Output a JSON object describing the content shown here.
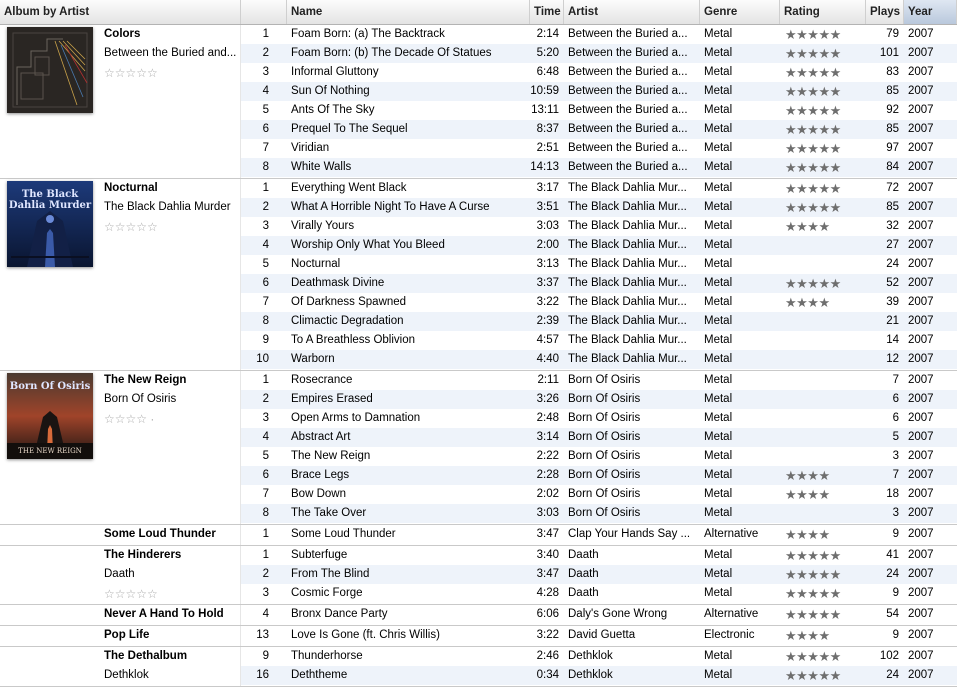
{
  "columns": {
    "album_by_artist": "Album by Artist",
    "name": "Name",
    "time": "Time",
    "artist": "Artist",
    "genre": "Genre",
    "rating": "Rating",
    "plays": "Plays",
    "year": "Year"
  },
  "albums": [
    {
      "title": "Colors",
      "artist": "Between the Buried and...",
      "album_rating": "☆☆☆☆☆",
      "has_art": true,
      "art": "colors",
      "tracks": [
        {
          "num": "1",
          "name": "Foam Born: (a) The Backtrack",
          "time": "2:14",
          "artist": "Between the Buried a...",
          "genre": "Metal",
          "rating": "★★★★★",
          "plays": "79",
          "year": "2007"
        },
        {
          "num": "2",
          "name": "Foam Born: (b) The Decade Of Statues",
          "time": "5:20",
          "artist": "Between the Buried a...",
          "genre": "Metal",
          "rating": "★★★★★",
          "plays": "101",
          "year": "2007"
        },
        {
          "num": "3",
          "name": "Informal Gluttony",
          "time": "6:48",
          "artist": "Between the Buried a...",
          "genre": "Metal",
          "rating": "★★★★★",
          "plays": "83",
          "year": "2007"
        },
        {
          "num": "4",
          "name": "Sun Of Nothing",
          "time": "10:59",
          "artist": "Between the Buried a...",
          "genre": "Metal",
          "rating": "★★★★★",
          "plays": "85",
          "year": "2007"
        },
        {
          "num": "5",
          "name": "Ants Of The Sky",
          "time": "13:11",
          "artist": "Between the Buried a...",
          "genre": "Metal",
          "rating": "★★★★★",
          "plays": "92",
          "year": "2007"
        },
        {
          "num": "6",
          "name": "Prequel To The Sequel",
          "time": "8:37",
          "artist": "Between the Buried a...",
          "genre": "Metal",
          "rating": "★★★★★",
          "plays": "85",
          "year": "2007"
        },
        {
          "num": "7",
          "name": "Viridian",
          "time": "2:51",
          "artist": "Between the Buried a...",
          "genre": "Metal",
          "rating": "★★★★★",
          "plays": "97",
          "year": "2007"
        },
        {
          "num": "8",
          "name": "White Walls",
          "time": "14:13",
          "artist": "Between the Buried a...",
          "genre": "Metal",
          "rating": "★★★★★",
          "plays": "84",
          "year": "2007"
        }
      ]
    },
    {
      "title": "Nocturnal",
      "artist": "The Black Dahlia Murder",
      "album_rating": "☆☆☆☆☆",
      "has_art": true,
      "art": "nocturnal",
      "art_text": "The Black Dahlia Murder",
      "tracks": [
        {
          "num": "1",
          "name": "Everything Went Black",
          "time": "3:17",
          "artist": "The Black Dahlia Mur...",
          "genre": "Metal",
          "rating": "★★★★★",
          "plays": "72",
          "year": "2007"
        },
        {
          "num": "2",
          "name": "What A Horrible Night To Have A Curse",
          "time": "3:51",
          "artist": "The Black Dahlia Mur...",
          "genre": "Metal",
          "rating": "★★★★★",
          "plays": "85",
          "year": "2007"
        },
        {
          "num": "3",
          "name": "Virally Yours",
          "time": "3:03",
          "artist": "The Black Dahlia Mur...",
          "genre": "Metal",
          "rating": "★★★★",
          "plays": "32",
          "year": "2007"
        },
        {
          "num": "4",
          "name": "Worship Only What You Bleed",
          "time": "2:00",
          "artist": "The Black Dahlia Mur...",
          "genre": "Metal",
          "rating": "",
          "plays": "27",
          "year": "2007"
        },
        {
          "num": "5",
          "name": "Nocturnal",
          "time": "3:13",
          "artist": "The Black Dahlia Mur...",
          "genre": "Metal",
          "rating": "",
          "plays": "24",
          "year": "2007"
        },
        {
          "num": "6",
          "name": "Deathmask Divine",
          "time": "3:37",
          "artist": "The Black Dahlia Mur...",
          "genre": "Metal",
          "rating": "★★★★★",
          "plays": "52",
          "year": "2007"
        },
        {
          "num": "7",
          "name": "Of Darkness Spawned",
          "time": "3:22",
          "artist": "The Black Dahlia Mur...",
          "genre": "Metal",
          "rating": "★★★★",
          "plays": "39",
          "year": "2007"
        },
        {
          "num": "8",
          "name": "Climactic Degradation",
          "time": "2:39",
          "artist": "The Black Dahlia Mur...",
          "genre": "Metal",
          "rating": "",
          "plays": "21",
          "year": "2007"
        },
        {
          "num": "9",
          "name": "To A Breathless Oblivion",
          "time": "4:57",
          "artist": "The Black Dahlia Mur...",
          "genre": "Metal",
          "rating": "",
          "plays": "14",
          "year": "2007"
        },
        {
          "num": "10",
          "name": "Warborn",
          "time": "4:40",
          "artist": "The Black Dahlia Mur...",
          "genre": "Metal",
          "rating": "",
          "plays": "12",
          "year": "2007"
        }
      ]
    },
    {
      "title": "The New Reign",
      "artist": "Born Of Osiris",
      "album_rating": "☆☆☆☆ ·",
      "has_art": true,
      "art": "newreign",
      "art_text": "Born Of Osiris",
      "art_sub": "THE NEW REIGN",
      "tracks": [
        {
          "num": "1",
          "name": "Rosecrance",
          "time": "2:11",
          "artist": "Born Of Osiris",
          "genre": "Metal",
          "rating": "",
          "plays": "7",
          "year": "2007"
        },
        {
          "num": "2",
          "name": "Empires Erased",
          "time": "3:26",
          "artist": "Born Of Osiris",
          "genre": "Metal",
          "rating": "",
          "plays": "6",
          "year": "2007"
        },
        {
          "num": "3",
          "name": "Open Arms to Damnation",
          "time": "2:48",
          "artist": "Born Of Osiris",
          "genre": "Metal",
          "rating": "",
          "plays": "6",
          "year": "2007"
        },
        {
          "num": "4",
          "name": "Abstract Art",
          "time": "3:14",
          "artist": "Born Of Osiris",
          "genre": "Metal",
          "rating": "",
          "plays": "5",
          "year": "2007"
        },
        {
          "num": "5",
          "name": "The New Reign",
          "time": "2:22",
          "artist": "Born Of Osiris",
          "genre": "Metal",
          "rating": "",
          "plays": "3",
          "year": "2007"
        },
        {
          "num": "6",
          "name": "Brace Legs",
          "time": "2:28",
          "artist": "Born Of Osiris",
          "genre": "Metal",
          "rating": "★★★★",
          "plays": "7",
          "year": "2007"
        },
        {
          "num": "7",
          "name": "Bow Down",
          "time": "2:02",
          "artist": "Born Of Osiris",
          "genre": "Metal",
          "rating": "★★★★",
          "plays": "18",
          "year": "2007"
        },
        {
          "num": "8",
          "name": "The Take Over",
          "time": "3:03",
          "artist": "Born Of Osiris",
          "genre": "Metal",
          "rating": "",
          "plays": "3",
          "year": "2007"
        }
      ]
    },
    {
      "title": "Some Loud Thunder",
      "artist": "",
      "album_rating": "",
      "has_art": false,
      "tracks": [
        {
          "num": "1",
          "name": "Some Loud Thunder",
          "time": "3:47",
          "artist": "Clap Your Hands Say ...",
          "genre": "Alternative",
          "rating": "★★★★",
          "plays": "9",
          "year": "2007"
        }
      ]
    },
    {
      "title": "The Hinderers",
      "artist": "Daath",
      "album_rating": "☆☆☆☆☆",
      "has_art": false,
      "tracks": [
        {
          "num": "1",
          "name": "Subterfuge",
          "time": "3:40",
          "artist": "Daath",
          "genre": "Metal",
          "rating": "★★★★★",
          "plays": "41",
          "year": "2007"
        },
        {
          "num": "2",
          "name": "From The Blind",
          "time": "3:47",
          "artist": "Daath",
          "genre": "Metal",
          "rating": "★★★★★",
          "plays": "24",
          "year": "2007"
        },
        {
          "num": "3",
          "name": "Cosmic Forge",
          "time": "4:28",
          "artist": "Daath",
          "genre": "Metal",
          "rating": "★★★★★",
          "plays": "9",
          "year": "2007"
        }
      ]
    },
    {
      "title": "Never A Hand To Hold",
      "artist": "",
      "album_rating": "",
      "has_art": false,
      "tracks": [
        {
          "num": "4",
          "name": "Bronx Dance Party",
          "time": "6:06",
          "artist": "Daly's Gone Wrong",
          "genre": "Alternative",
          "rating": "★★★★★",
          "plays": "54",
          "year": "2007"
        }
      ]
    },
    {
      "title": "Pop Life",
      "artist": "",
      "album_rating": "",
      "has_art": false,
      "tracks": [
        {
          "num": "13",
          "name": "Love Is Gone (ft. Chris Willis)",
          "time": "3:22",
          "artist": "David Guetta",
          "genre": "Electronic",
          "rating": "★★★★",
          "plays": "9",
          "year": "2007"
        }
      ]
    },
    {
      "title": "The Dethalbum",
      "artist": "Dethklok",
      "album_rating": "",
      "has_art": false,
      "tracks": [
        {
          "num": "9",
          "name": "Thunderhorse",
          "time": "2:46",
          "artist": "Dethklok",
          "genre": "Metal",
          "rating": "★★★★★",
          "plays": "102",
          "year": "2007"
        },
        {
          "num": "16",
          "name": "Deththeme",
          "time": "0:34",
          "artist": "Dethklok",
          "genre": "Metal",
          "rating": "★★★★★",
          "plays": "24",
          "year": "2007"
        }
      ]
    }
  ]
}
